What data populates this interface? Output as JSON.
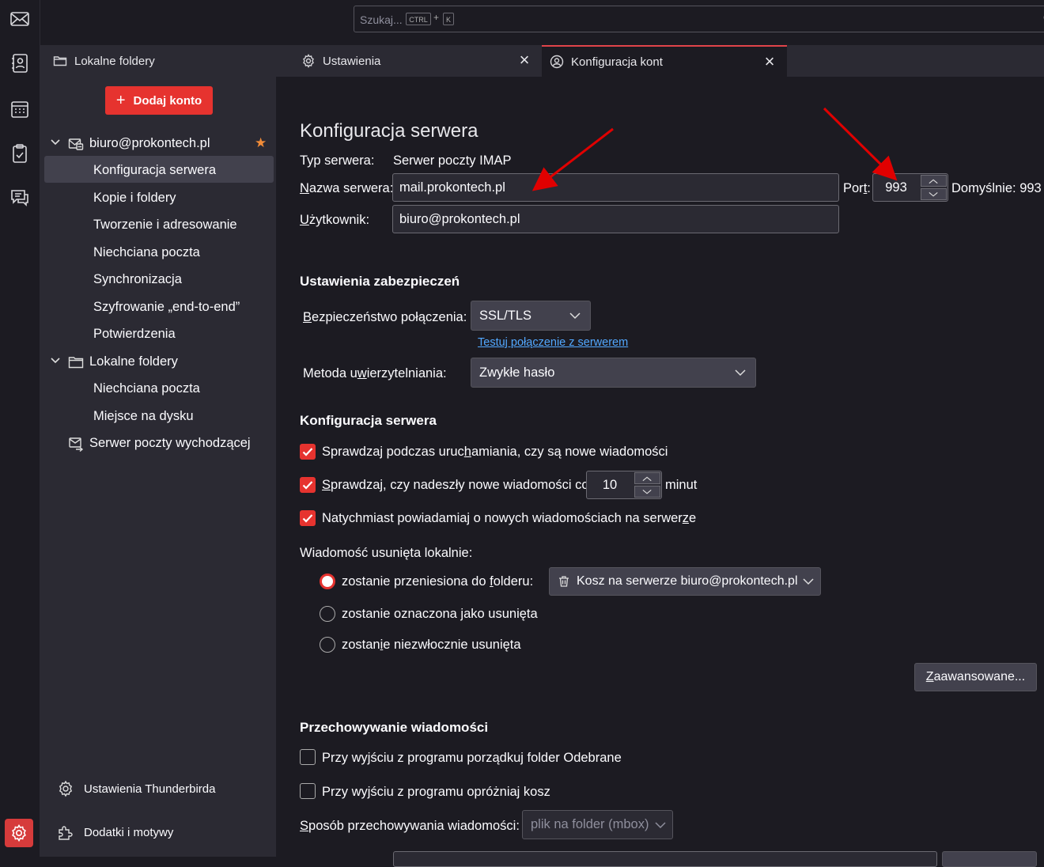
{
  "search": {
    "placeholder": "Szukaj...",
    "kbd1": "CTRL",
    "plus": "+",
    "kbd2": "K"
  },
  "tabs": [
    {
      "label": "Lokalne foldery",
      "icon": "folder-icon"
    },
    {
      "label": "Ustawienia",
      "icon": "gear-icon"
    },
    {
      "label": "Konfiguracja kont",
      "icon": "account-icon"
    }
  ],
  "sidebar": {
    "add_account": "Dodaj konto",
    "account": "biuro@prokontech.pl",
    "account_items": [
      "Konfiguracja serwera",
      "Kopie i foldery",
      "Tworzenie i adresowanie",
      "Niechciana poczta",
      "Synchronizacja",
      "Szyfrowanie „end-to-end”",
      "Potwierdzenia"
    ],
    "local": "Lokalne foldery",
    "local_items": [
      "Niechciana poczta",
      "Miejsce na dysku"
    ],
    "smtp": "Serwer poczty wychodzącej",
    "footer_settings": "Ustawienia Thunderbirda",
    "footer_addons": "Dodatki i motywy"
  },
  "main": {
    "title": "Konfiguracja serwera",
    "server_type_label": "Typ serwera:",
    "server_type_value": "Serwer poczty IMAP",
    "server_name_label_u": "N",
    "server_name_label_rest": "azwa serwera:",
    "server_name_value": "mail.prokontech.pl",
    "port_label_a": "Por",
    "port_label_u": "t",
    "port_label_b": ":",
    "port_value": "993",
    "port_default": "Domyślnie: 993",
    "user_label_u": "U",
    "user_label_rest": "żytkownik:",
    "user_value": "biuro@prokontech.pl",
    "security_heading": "Ustawienia zabezpieczeń",
    "conn_security_label_u": "B",
    "conn_security_label_rest": "ezpieczeństwo połączenia:",
    "conn_security_value": "SSL/TLS",
    "test_link": "Testuj połączenie z serwerem",
    "auth_label_a": "Metoda u",
    "auth_label_u": "w",
    "auth_label_b": "ierzytelniania:",
    "auth_value": "Zwykłe hasło",
    "server_heading": "Konfiguracja serwera",
    "check_startup_a": "Sprawdzaj podczas uruc",
    "check_startup_u": "h",
    "check_startup_b": "amiania, czy są nowe wiadomości",
    "check_every_u": "S",
    "check_every_rest": "prawdzaj, czy nadeszły nowe wiadomości co",
    "check_every_value": "10",
    "minutes": "minut",
    "notify_a": "Natychmiast powiadamiaj o nowych wiadomościach na serwer",
    "notify_u": "z",
    "notify_b": "e",
    "deleted_label": "Wiadomość usunięta lokalnie:",
    "radio_move_a": "zostanie przeniesiona do ",
    "radio_move_u": "f",
    "radio_move_b": "olderu:",
    "trash_folder": "Kosz na serwerze biuro@prokontech.pl",
    "radio_mark": "zostanie oznaczona jako usunięta",
    "radio_delete_a": "zostan",
    "radio_delete_u": "i",
    "radio_delete_b": "e niezwłocznie usunięta",
    "advanced_u": "Z",
    "advanced_rest": "aawansowane...",
    "storage_heading": "Przechowywanie wiadomości",
    "cleanup_a": "Przy wyjściu z programu porządkuj folder Odebrane",
    "cleanup_u_a": "Przy wyjściu z programu porządkuj folder Odebrane",
    "empty_trash": "Przy wyjściu z programu opróżniaj kosz",
    "store_label_u": "S",
    "store_label_rest": "posób przechowywania wiadomości:",
    "store_value": "plik na folder (mbox)"
  },
  "colors": {
    "accent": "#e6332f",
    "link": "#52a8ff"
  }
}
